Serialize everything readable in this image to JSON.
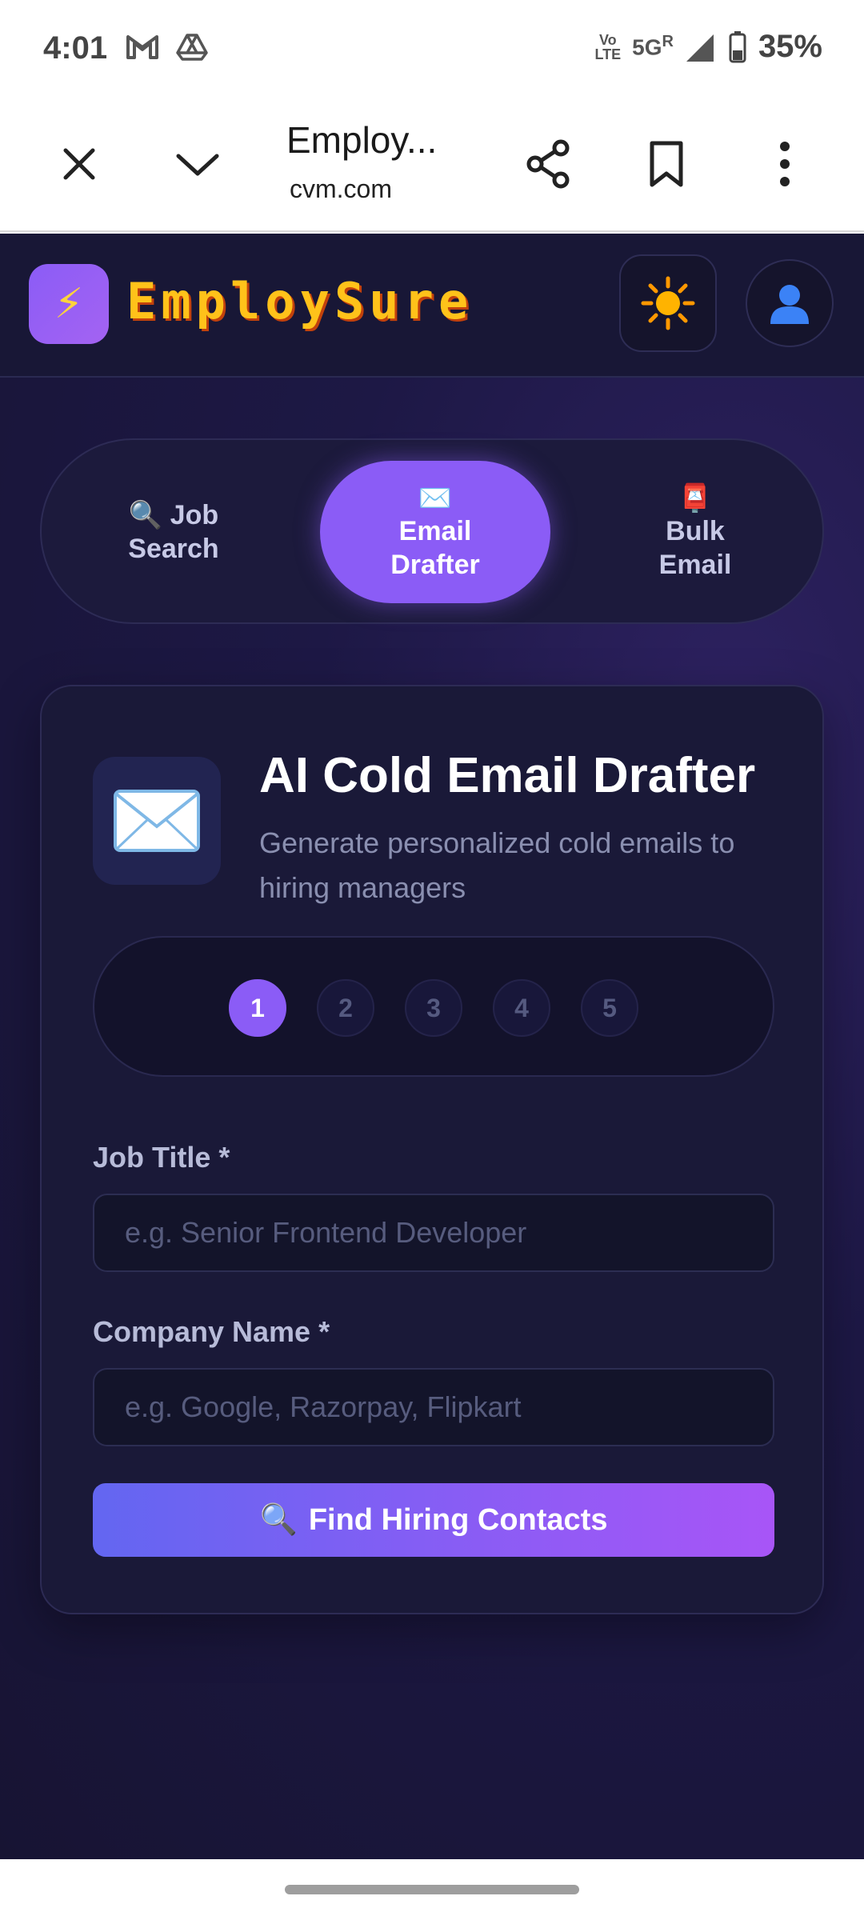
{
  "status_bar": {
    "time": "4:01",
    "volte_line1": "Vo",
    "volte_line2": "LTE",
    "network": "5G",
    "roaming": "R",
    "battery": "35%"
  },
  "browser": {
    "title": "Employ...",
    "url": "cvm.com"
  },
  "app": {
    "brand": "EmploySure",
    "logo_icon": "lightning-icon",
    "theme_icon": "sun-icon",
    "profile_icon": "user-icon"
  },
  "tabs": [
    {
      "emoji": "🔍",
      "label_line1": "Job",
      "label_line2": "Search",
      "active": false
    },
    {
      "emoji": "✉️",
      "label_line1": "Email",
      "label_line2": "Drafter",
      "active": true
    },
    {
      "emoji": "📮",
      "label_line1": "Bulk",
      "label_line2": "Email",
      "active": false
    }
  ],
  "card": {
    "title": "AI Cold Email Drafter",
    "subtitle": "Generate personalized cold emails to hiring managers",
    "icon": "envelope-icon",
    "steps": [
      "1",
      "2",
      "3",
      "4",
      "5"
    ],
    "active_step": 1,
    "job_title": {
      "label": "Job Title *",
      "placeholder": "e.g. Senior Frontend Developer",
      "value": ""
    },
    "company_name": {
      "label": "Company Name *",
      "placeholder": "e.g. Google, Razorpay, Flipkart",
      "value": ""
    },
    "find_button": {
      "emoji": "🔍",
      "label": "Find Hiring Contacts"
    }
  },
  "colors": {
    "accent": "#8b5cf6",
    "brand_text": "#ffc21a",
    "background": "#1d1845"
  }
}
